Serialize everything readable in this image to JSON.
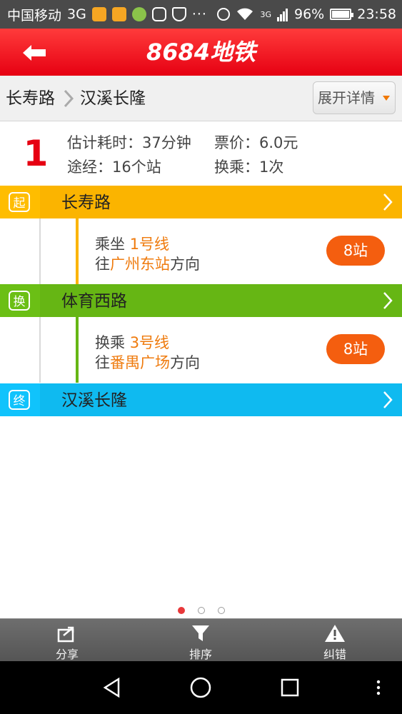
{
  "status_bar": {
    "carrier": "中国移动",
    "network": "3G",
    "more": "···",
    "data_type": "3G",
    "battery": "96%",
    "time": "23:58"
  },
  "header": {
    "title": "8684地铁"
  },
  "route": {
    "from": "长寿路",
    "to": "汉溪长隆",
    "expand_label": "展开详情"
  },
  "summary": {
    "number": "1",
    "time_label": "估计耗时：37分钟",
    "fare_label": "票价：6.0元",
    "stations_label": "途经：16个站",
    "transfer_label": "换乘：1次"
  },
  "stations": [
    {
      "badge": "起",
      "name": "长寿路",
      "color": "#fbb400"
    },
    {
      "badge": "换",
      "name": "体育西路",
      "color": "#66b614"
    },
    {
      "badge": "终",
      "name": "汉溪长隆",
      "color": "#0fbaf0"
    }
  ],
  "segments": [
    {
      "action": "乘坐 ",
      "line": "1号线",
      "dir_prefix": "往",
      "direction": "广州东站",
      "dir_suffix": "方向",
      "stops": "8站",
      "color": "#fbb400"
    },
    {
      "action": "换乘 ",
      "line": "3号线",
      "dir_prefix": "往",
      "direction": "番禺广场",
      "dir_suffix": "方向",
      "stops": "8站",
      "color": "#66b614"
    }
  ],
  "pager": {
    "total": 3,
    "active": 0
  },
  "toolbar": {
    "share": "分享",
    "sort": "排序",
    "report": "纠错"
  },
  "colors": {
    "accent": "#e60012",
    "highlight": "#ef7b0e",
    "pill": "#f45e0f"
  }
}
